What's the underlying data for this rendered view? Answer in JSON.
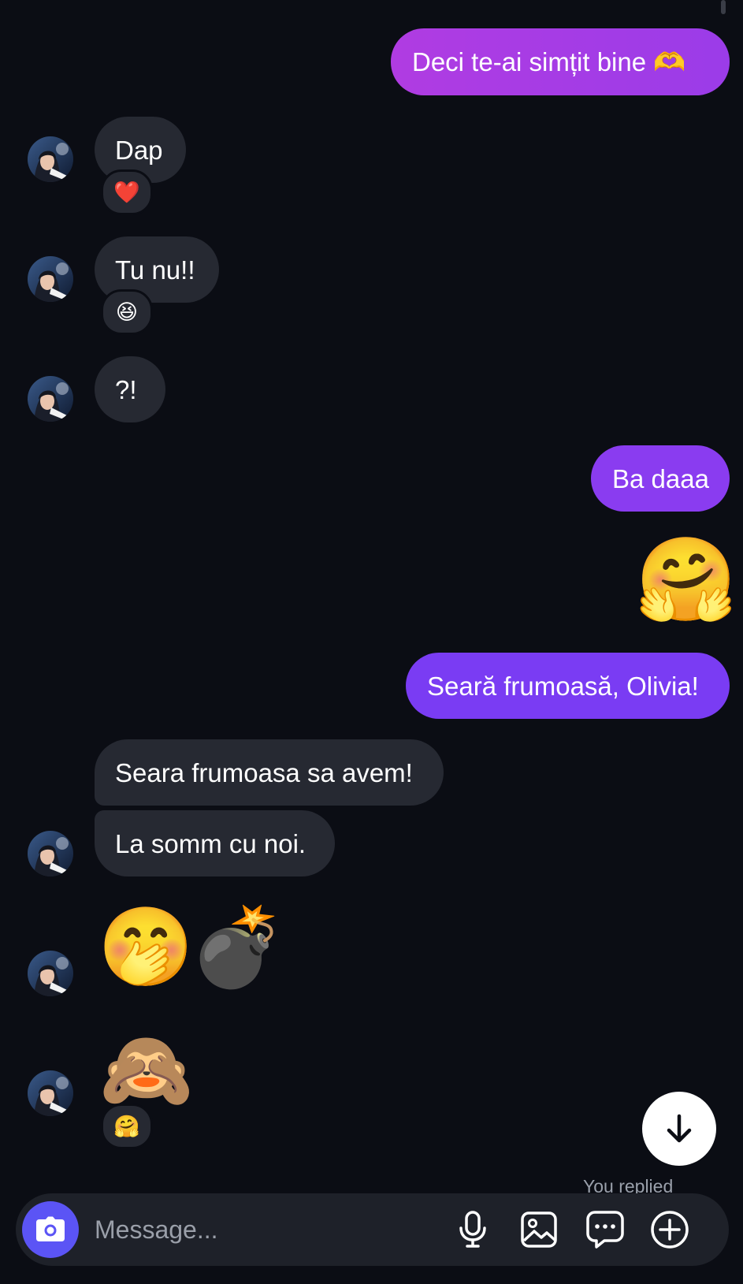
{
  "messages": {
    "m1": "Deci te-ai simțit bine 🫶",
    "m2": "Dap",
    "m2_reaction": "❤️",
    "m3": "Tu nu!!",
    "m3_reaction": "😆",
    "m4": "?!",
    "m5": "Ba daaa",
    "m6": "🤗",
    "m7": "Seară frumoasă, Olivia!",
    "m8": "Seara frumoasa sa avem!",
    "m9": "La somm cu noi.",
    "m10a": "🤭",
    "m10b": "💣",
    "m11": "🙈",
    "m11_reaction": "🤗"
  },
  "status": {
    "you_replied": "You replied"
  },
  "composer": {
    "placeholder": "Message..."
  },
  "icons": {
    "camera": "camera-icon",
    "mic": "microphone-icon",
    "gallery": "gallery-icon",
    "sticker": "chat-bubble-icon",
    "add": "plus-circle-icon",
    "scroll_down": "arrow-down-icon"
  },
  "colors": {
    "background": "#0b0d14",
    "incoming_bubble": "#262932",
    "outgoing_gradient_start": "#a93ae0",
    "outgoing_gradient_end": "#6b3cf6",
    "camera_button": "#5b54f5"
  }
}
